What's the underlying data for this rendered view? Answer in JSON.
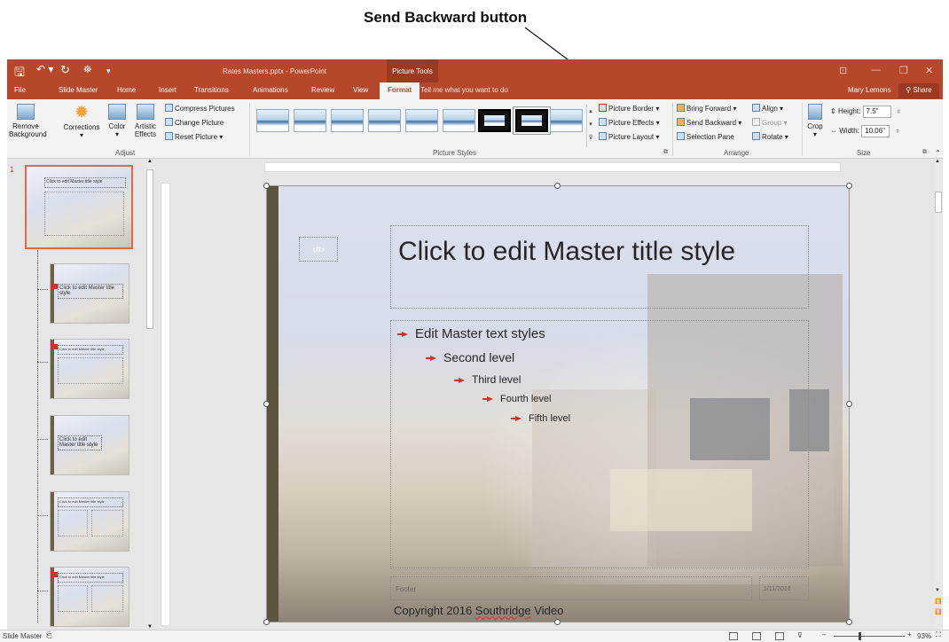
{
  "callout": {
    "label": "Send Backward button"
  },
  "titlebar": {
    "save_icon": "save-icon",
    "undo_label": "↶ ▾",
    "redo_label": "↻",
    "customize_label": "▾",
    "document_title": "Rates Masters.pptx - PowerPoint",
    "tools_tab": "Picture Tools",
    "colors": {
      "bar": "#b7472a",
      "tools": "#9c3a21"
    }
  },
  "tabs": {
    "file": "File",
    "slide_master": "Slide Master",
    "home": "Home",
    "insert": "Insert",
    "transitions": "Transitions",
    "animations": "Animations",
    "review": "Review",
    "view": "View",
    "format": "Format",
    "tell_me": "Tell me what you want to do",
    "user": "Mary Lemons",
    "share": "Share"
  },
  "ribbon": {
    "adjust": {
      "remove_background": "Remove Background",
      "corrections": "Corrections",
      "color": "Color",
      "artistic_effects": "Artistic Effects",
      "compress_pictures": "Compress Pictures",
      "change_picture": "Change Picture",
      "reset_picture": "Reset Picture",
      "group_label": "Adjust"
    },
    "picture_styles": {
      "picture_border": "Picture Border",
      "picture_effects": "Picture Effects",
      "picture_layout": "Picture Layout",
      "group_label": "Picture Styles"
    },
    "arrange": {
      "bring_forward": "Bring Forward",
      "send_backward": "Send Backward",
      "selection_pane": "Selection Pane",
      "align": "Align",
      "group": "Group",
      "rotate": "Rotate",
      "group_label": "Arrange"
    },
    "size": {
      "crop": "Crop",
      "height_label": "Height:",
      "height_value": "7.5\"",
      "width_label": "Width:",
      "width_value": "10.06\"",
      "group_label": "Size"
    }
  },
  "thumbnails": {
    "slide_number": "1",
    "items": [
      {
        "title": "Click to edit Master title style"
      },
      {
        "title": "Click to edit Master title style"
      },
      {
        "title": "Click to edit Master title style"
      },
      {
        "title": "Click to edit Master title style"
      },
      {
        "title": "Click to edit Master title style"
      },
      {
        "title": "Click to edit Master title style"
      }
    ]
  },
  "slide": {
    "title": "Click to edit Master title style",
    "slide_number_placeholder": "‹#›",
    "levels": [
      "Edit Master text styles",
      "Second level",
      "Third level",
      "Fourth level",
      "Fifth level"
    ],
    "footer": "Footer",
    "date": "1/11/2016",
    "copyright_prefix": "Copyright 2016 ",
    "copyright_brand": "Southridge",
    "copyright_suffix": " Video"
  },
  "statusbar": {
    "view_label": "Slide Master",
    "zoom": "93%"
  }
}
